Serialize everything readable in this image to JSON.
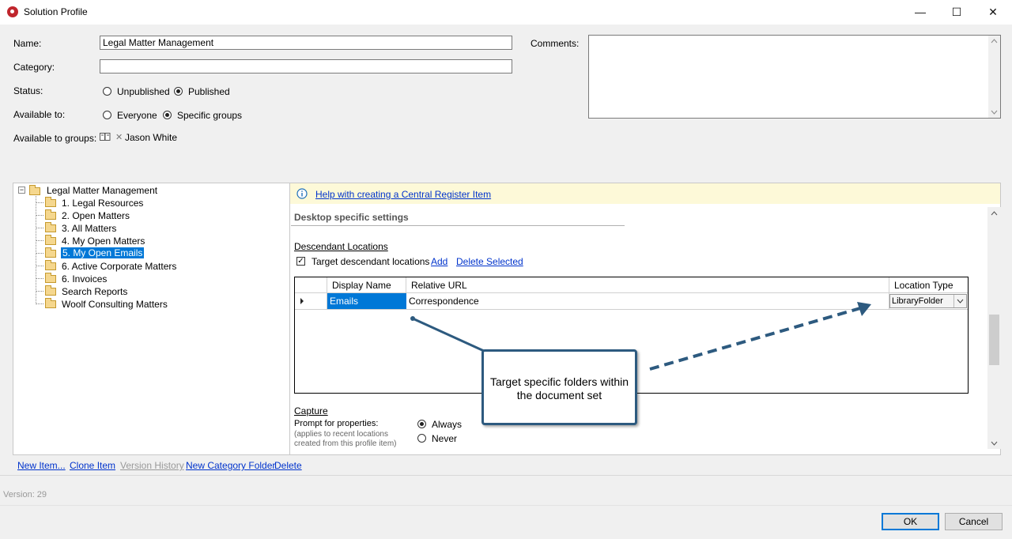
{
  "window": {
    "title": "Solution Profile",
    "minimize_glyph": "—",
    "maximize_glyph": "☐",
    "close_glyph": "✕"
  },
  "form": {
    "name_label": "Name:",
    "name_value": "Legal Matter Management",
    "category_label": "Category:",
    "category_value": "",
    "status_label": "Status:",
    "status_options": [
      "Unpublished",
      "Published"
    ],
    "status_selected": "Published",
    "available_label": "Available to:",
    "available_options": [
      "Everyone",
      "Specific groups"
    ],
    "available_selected": "Specific groups",
    "groups_label": "Available to groups:",
    "group_remove_glyph": "✕",
    "group_name": "Jason White",
    "comments_label": "Comments:",
    "comments_value": ""
  },
  "tree": {
    "root": "Legal Matter Management",
    "items": [
      "1. Legal Resources",
      "2. Open Matters",
      "3. All Matters",
      "4. My Open Matters",
      "5. My Open Emails",
      "6. Active Corporate Matters",
      "6. Invoices",
      "Search Reports",
      "Woolf Consulting Matters"
    ],
    "selected_index": 4,
    "expander_glyph": "−"
  },
  "detail": {
    "help_link": "Help with creating a Central Register Item",
    "section_title": "Desktop specific settings",
    "descendant_heading": "Descendant Locations",
    "target_checkbox_label": "Target descendant locations",
    "target_checked": true,
    "add_link": "Add",
    "delete_link": "Delete Selected",
    "grid": {
      "columns": [
        "Display Name",
        "Relative URL",
        "Location Type"
      ],
      "rows": [
        {
          "display_name": "Emails",
          "relative_url": "Correspondence",
          "location_type": "LibraryFolder"
        }
      ]
    },
    "capture_heading": "Capture",
    "prompt_label": "Prompt for properties:",
    "prompt_note": "(applies to recent locations created from this profile item)",
    "prompt_options": [
      "Always",
      "Never"
    ],
    "prompt_selected": "Always",
    "callout_text": "Target specific folders within the document set"
  },
  "bottom_links": {
    "new_item": "New Item...",
    "clone_item": "Clone Item",
    "version_history": "Version History",
    "new_category_folder": "New Category Folder",
    "delete": "Delete"
  },
  "footer": {
    "version": "Version: 29",
    "ok": "OK",
    "cancel": "Cancel"
  },
  "colors": {
    "selection": "#0078d7",
    "link": "#0033cc",
    "callout_border": "#2d5a7f",
    "help_bar": "#fdf9d8"
  }
}
